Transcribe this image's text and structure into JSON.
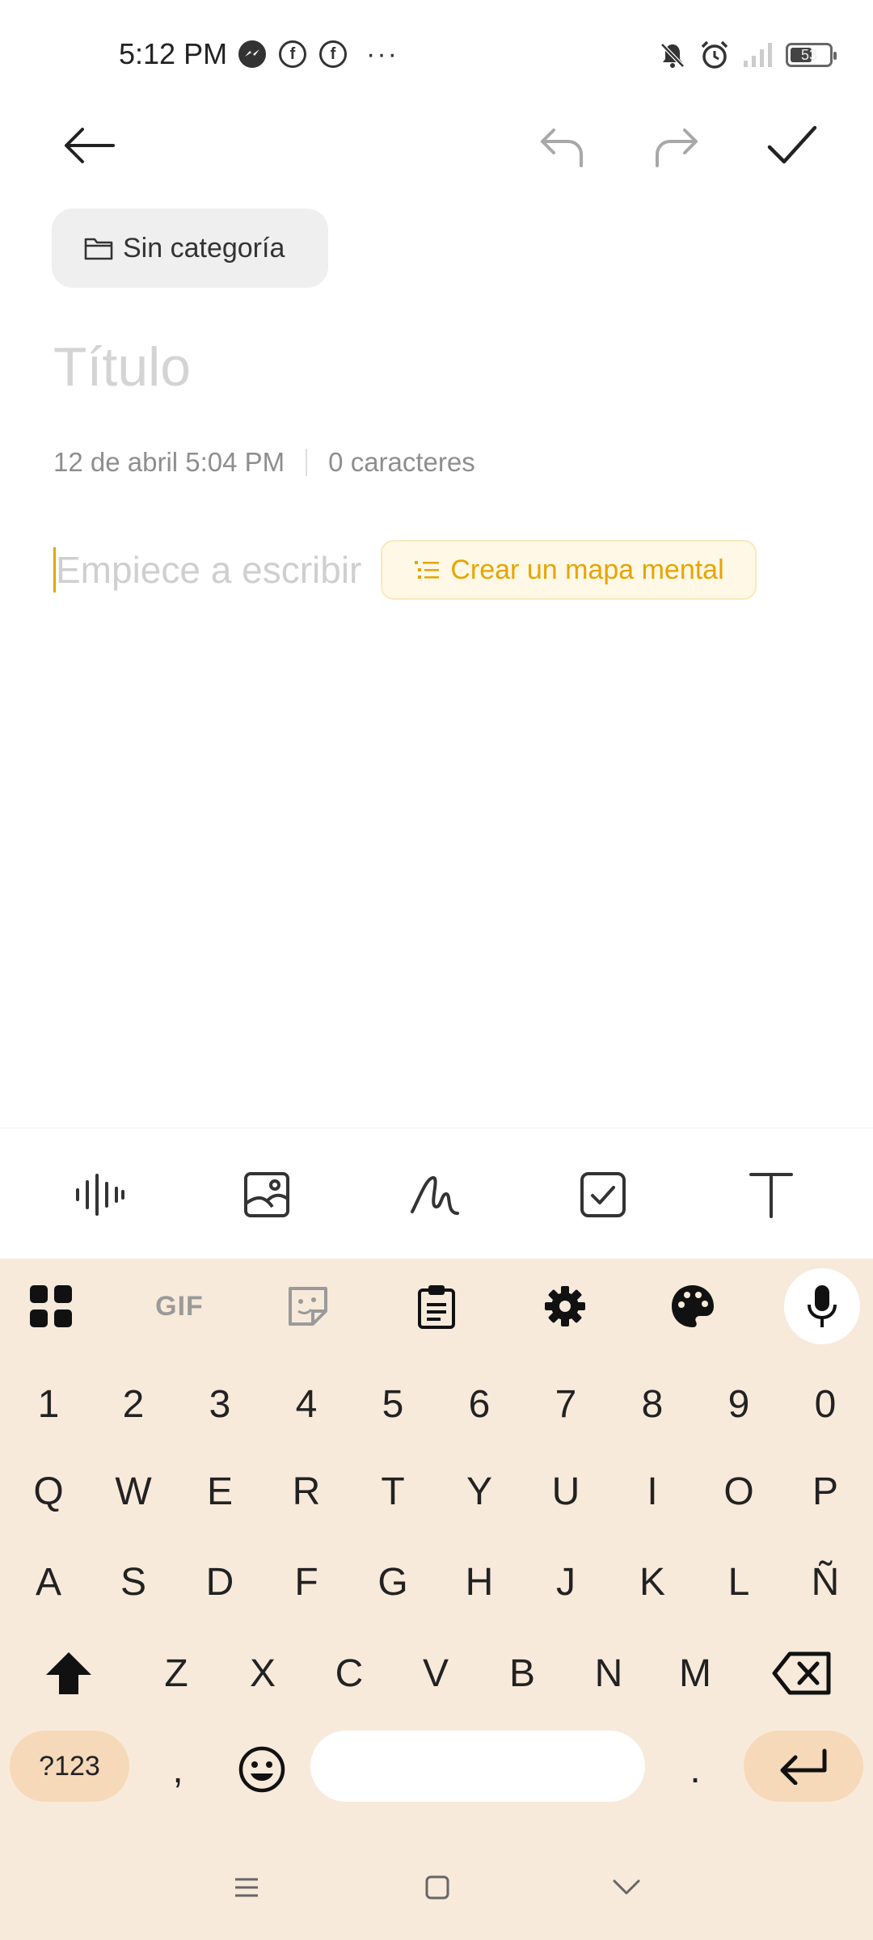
{
  "status_bar": {
    "time": "5:12 PM",
    "left_icons": [
      "messenger-icon",
      "facebook-icon",
      "facebook-icon"
    ],
    "more": "···",
    "right_icons": [
      "mute-icon",
      "alarm-icon",
      "signal-icon"
    ],
    "battery": "53"
  },
  "topbar": {
    "icons": [
      "back-arrow-icon",
      "undo-icon",
      "redo-icon",
      "checkmark-icon"
    ]
  },
  "category_chip": {
    "icon": "folder-icon",
    "label": "Sin categoría"
  },
  "note": {
    "title_placeholder": "Título",
    "date": "12 de abril 5:04 PM",
    "char_count": "0 caracteres",
    "body_placeholder": "Empiece a escribir",
    "mindmap_button": "Crear un mapa mental"
  },
  "note_toolbar": [
    "audio-icon",
    "image-icon",
    "handwriting-icon",
    "checklist-icon",
    "text-format-icon"
  ],
  "keyboard": {
    "tools": [
      "apps-grid-icon",
      "gif-icon",
      "sticker-icon",
      "clipboard-icon",
      "settings-icon",
      "palette-icon",
      "microphone-icon"
    ],
    "gif_label": "GIF",
    "row_numbers": [
      "1",
      "2",
      "3",
      "4",
      "5",
      "6",
      "7",
      "8",
      "9",
      "0"
    ],
    "row_1": [
      "Q",
      "W",
      "E",
      "R",
      "T",
      "Y",
      "U",
      "I",
      "O",
      "P"
    ],
    "row_2": [
      "A",
      "S",
      "D",
      "F",
      "G",
      "H",
      "J",
      "K",
      "L",
      "Ñ"
    ],
    "row_3": [
      "Z",
      "X",
      "C",
      "V",
      "B",
      "N",
      "M"
    ],
    "symbols_key": "?123",
    "comma_key": ",",
    "period_key": "."
  },
  "colors": {
    "accent": "#E8A400",
    "keyboard_bg": "#F8EADB",
    "key_accent_bg": "#F6D9B9"
  }
}
